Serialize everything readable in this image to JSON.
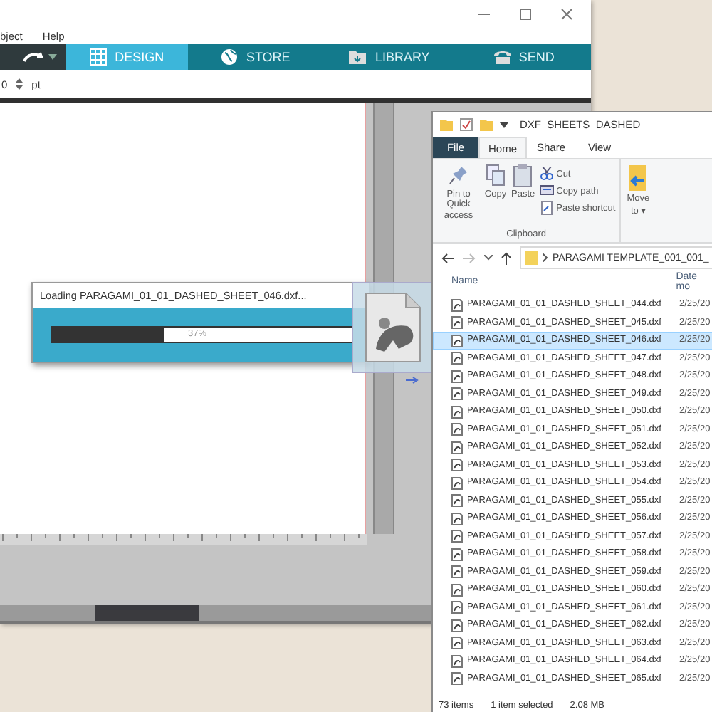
{
  "app": {
    "menu": [
      "bject",
      "Help"
    ],
    "tabs": [
      {
        "label": "DESIGN",
        "selected": true
      },
      {
        "label": "STORE",
        "selected": false
      },
      {
        "label": "LIBRARY",
        "selected": false
      },
      {
        "label": "SEND",
        "selected": false
      }
    ],
    "toolbar": {
      "value": "0",
      "unit": "pt"
    }
  },
  "loading_dialog": {
    "title": "Loading PARAGAMI_01_01_DASHED_SHEET_046.dxf...",
    "level": 0.37,
    "reading": "37%"
  },
  "explorer": {
    "title": "DXF_SHEETS_DASHED",
    "ribbon_tabs": [
      {
        "label": "File",
        "kind": "menu",
        "selected": false
      },
      {
        "label": "Home",
        "kind": "tab",
        "selected": true
      },
      {
        "label": "Share",
        "kind": "tab",
        "selected": false
      },
      {
        "label": "View",
        "kind": "tab",
        "selected": false
      }
    ],
    "clipboard": {
      "large_buttons": [
        "Pin to Quick access",
        "Copy",
        "Paste"
      ],
      "small_buttons": [
        "Cut",
        "Copy path",
        "Paste shortcut"
      ],
      "group_label": "Clipboard"
    },
    "move_to": {
      "label": "Move",
      "caption": "to ▾"
    },
    "address": "PARAGAMI TEMPLATE_001_001_",
    "columns": [
      "Name",
      "Date mo"
    ],
    "files": [
      {
        "name": "PARAGAMI_01_01_DASHED_SHEET_044.dxf",
        "date": "2/25/20",
        "selected": false
      },
      {
        "name": "PARAGAMI_01_01_DASHED_SHEET_045.dxf",
        "date": "2/25/20",
        "selected": false
      },
      {
        "name": "PARAGAMI_01_01_DASHED_SHEET_046.dxf",
        "date": "2/25/20",
        "selected": true
      },
      {
        "name": "PARAGAMI_01_01_DASHED_SHEET_047.dxf",
        "date": "2/25/20",
        "selected": false
      },
      {
        "name": "PARAGAMI_01_01_DASHED_SHEET_048.dxf",
        "date": "2/25/20",
        "selected": false
      },
      {
        "name": "PARAGAMI_01_01_DASHED_SHEET_049.dxf",
        "date": "2/25/20",
        "selected": false
      },
      {
        "name": "PARAGAMI_01_01_DASHED_SHEET_050.dxf",
        "date": "2/25/20",
        "selected": false
      },
      {
        "name": "PARAGAMI_01_01_DASHED_SHEET_051.dxf",
        "date": "2/25/20",
        "selected": false
      },
      {
        "name": "PARAGAMI_01_01_DASHED_SHEET_052.dxf",
        "date": "2/25/20",
        "selected": false
      },
      {
        "name": "PARAGAMI_01_01_DASHED_SHEET_053.dxf",
        "date": "2/25/20",
        "selected": false
      },
      {
        "name": "PARAGAMI_01_01_DASHED_SHEET_054.dxf",
        "date": "2/25/20",
        "selected": false
      },
      {
        "name": "PARAGAMI_01_01_DASHED_SHEET_055.dxf",
        "date": "2/25/20",
        "selected": false
      },
      {
        "name": "PARAGAMI_01_01_DASHED_SHEET_056.dxf",
        "date": "2/25/20",
        "selected": false
      },
      {
        "name": "PARAGAMI_01_01_DASHED_SHEET_057.dxf",
        "date": "2/25/20",
        "selected": false
      },
      {
        "name": "PARAGAMI_01_01_DASHED_SHEET_058.dxf",
        "date": "2/25/20",
        "selected": false
      },
      {
        "name": "PARAGAMI_01_01_DASHED_SHEET_059.dxf",
        "date": "2/25/20",
        "selected": false
      },
      {
        "name": "PARAGAMI_01_01_DASHED_SHEET_060.dxf",
        "date": "2/25/20",
        "selected": false
      },
      {
        "name": "PARAGAMI_01_01_DASHED_SHEET_061.dxf",
        "date": "2/25/20",
        "selected": false
      },
      {
        "name": "PARAGAMI_01_01_DASHED_SHEET_062.dxf",
        "date": "2/25/20",
        "selected": false
      },
      {
        "name": "PARAGAMI_01_01_DASHED_SHEET_063.dxf",
        "date": "2/25/20",
        "selected": false
      },
      {
        "name": "PARAGAMI_01_01_DASHED_SHEET_064.dxf",
        "date": "2/25/20",
        "selected": false
      },
      {
        "name": "PARAGAMI_01_01_DASHED_SHEET_065.dxf",
        "date": "2/25/20",
        "selected": false
      }
    ],
    "status": [
      "73 items",
      "1 item selected",
      "2.08 MB"
    ]
  }
}
